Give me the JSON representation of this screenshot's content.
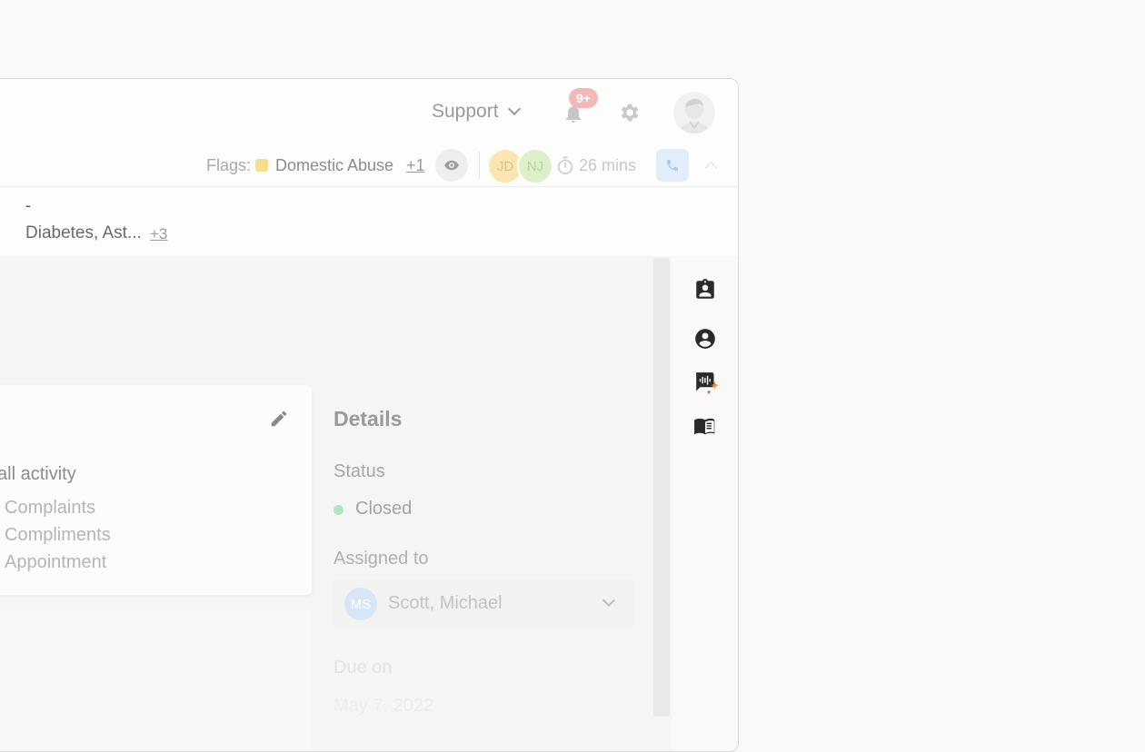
{
  "header": {
    "org_select": "Support",
    "notifications_badge": "9+"
  },
  "flag_bar": {
    "flags_label": "Flags:",
    "flag_name": "Domestic Abuse",
    "flag_more": "+1",
    "participants": [
      "JD",
      "NJ"
    ],
    "timer": "26 mins",
    "flag_color": "#f7df8a"
  },
  "patient_info": {
    "dash_value": "-",
    "truncated_label": ".",
    "conditions": "Diabetes, Ast...",
    "conditions_more": "+3"
  },
  "card": {
    "heading": "all activity",
    "items": [
      "Complaints",
      "Compliments",
      "Appointment"
    ]
  },
  "details": {
    "title": "Details",
    "status_label": "Status",
    "status_value": "Closed",
    "status_color": "#b7e3c1",
    "assigned_label": "Assigned to",
    "assignee_initials": "MS",
    "assignee_name": "Scott, Michael",
    "due_label": "Due on",
    "due_value": "May 7, 2022"
  },
  "icons": {
    "rail": [
      "assignment-ind-icon",
      "account-circle-icon",
      "voice-chat-ai-icon",
      "menu-book-icon"
    ]
  }
}
